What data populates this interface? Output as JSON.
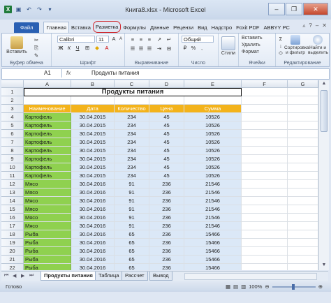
{
  "window": {
    "title": "Книга8.xlsx - Microsoft Excel"
  },
  "tabs": [
    "Файл",
    "Главная",
    "Вставка",
    "Разметка",
    "Формулы",
    "Данные",
    "Рецензи",
    "Вид",
    "Надстро",
    "Foxit PDF",
    "ABBYY PC"
  ],
  "ribbon": {
    "paste": "Вставить",
    "font_name": "Calibri",
    "font_size": "11",
    "number_format": "Общий",
    "styles": "Стили",
    "insert": "Вставить",
    "delete": "Удалить",
    "format": "Формат",
    "sort": "Сортировка и фильтр",
    "find": "Найти и выделить",
    "groups": [
      "Буфер обмена",
      "Шрифт",
      "Выравнивание",
      "Число",
      "Ячейки",
      "Редактирование"
    ]
  },
  "formula_bar": {
    "name_box": "A1",
    "fx": "fx",
    "value": "Продукты питания"
  },
  "columns": [
    "A",
    "B",
    "C",
    "D",
    "E",
    "F",
    "G"
  ],
  "title_row": "Продукты питания",
  "headers": [
    "Наименование",
    "Дата",
    "Количество",
    "Цена",
    "Сумма"
  ],
  "rows": [
    [
      "Картофель",
      "30.04.2015",
      "234",
      "45",
      "10526"
    ],
    [
      "Картофель",
      "30.04.2015",
      "234",
      "45",
      "10526"
    ],
    [
      "Картофель",
      "30.04.2015",
      "234",
      "45",
      "10526"
    ],
    [
      "Картофель",
      "30.04.2015",
      "234",
      "45",
      "10526"
    ],
    [
      "Картофель",
      "30.04.2015",
      "234",
      "45",
      "10526"
    ],
    [
      "Картофель",
      "30.04.2015",
      "234",
      "45",
      "10526"
    ],
    [
      "Картофель",
      "30.04.2015",
      "234",
      "45",
      "10526"
    ],
    [
      "Картофель",
      "30.04.2015",
      "234",
      "45",
      "10526"
    ],
    [
      "Мясо",
      "30.04.2016",
      "91",
      "236",
      "21546"
    ],
    [
      "Мясо",
      "30.04.2016",
      "91",
      "236",
      "21546"
    ],
    [
      "Мясо",
      "30.04.2016",
      "91",
      "236",
      "21546"
    ],
    [
      "Мясо",
      "30.04.2016",
      "91",
      "236",
      "21546"
    ],
    [
      "Мясо",
      "30.04.2016",
      "91",
      "236",
      "21546"
    ],
    [
      "Мясо",
      "30.04.2016",
      "91",
      "236",
      "21546"
    ],
    [
      "Рыба",
      "30.04.2016",
      "65",
      "236",
      "15466"
    ],
    [
      "Рыба",
      "30.04.2016",
      "65",
      "236",
      "15466"
    ],
    [
      "Рыба",
      "30.04.2016",
      "65",
      "236",
      "15466"
    ],
    [
      "Рыба",
      "30.04.2016",
      "65",
      "236",
      "15466"
    ],
    [
      "Рыба",
      "30.04.2016",
      "65",
      "236",
      "15466"
    ]
  ],
  "row_numbers": [
    "1",
    "2",
    "3",
    "4",
    "5",
    "6",
    "7",
    "8",
    "9",
    "10",
    "11",
    "12",
    "13",
    "14",
    "15",
    "16",
    "17",
    "18",
    "19",
    "20",
    "21",
    "22",
    "23",
    "24"
  ],
  "sheets": [
    "Продукты питания",
    "Таблица",
    "Рассчет",
    "Вывод"
  ],
  "status": {
    "ready": "Готово",
    "zoom": "100%"
  },
  "colors": {
    "header_fill": "#f3b31b",
    "name_fill": "#8fd14f",
    "highlight": "#d0282d"
  }
}
